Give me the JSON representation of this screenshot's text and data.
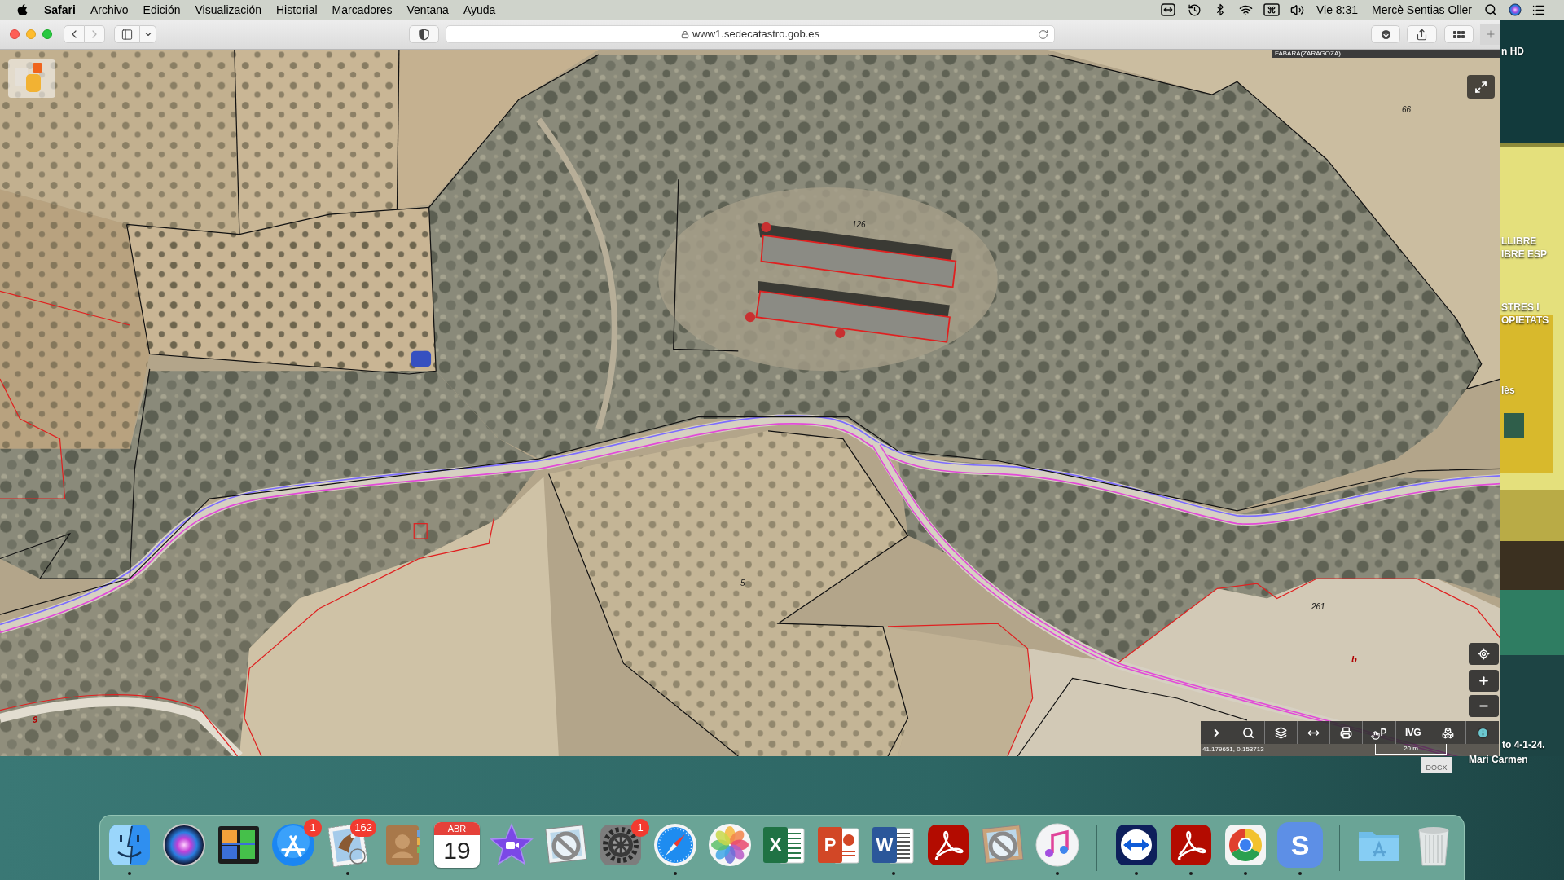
{
  "menu_bar": {
    "app_name": "Safari",
    "menus": [
      "Archivo",
      "Edición",
      "Visualización",
      "Historial",
      "Marcadores",
      "Ventana",
      "Ayuda"
    ],
    "clock": "Vie 8:31",
    "user": "Mercè Sentias Oller"
  },
  "browser": {
    "url": "www1.sedecatastro.gob.es",
    "back_disabled": false,
    "forward_disabled": true
  },
  "map": {
    "region_label": "FABARA(ZARAGOZA)",
    "parcel_labels": [
      {
        "text": "66",
        "kind": "parcel"
      },
      {
        "text": "126",
        "kind": "parcel"
      },
      {
        "text": "5",
        "kind": "parcel"
      },
      {
        "text": "261",
        "kind": "parcel"
      },
      {
        "text": "9",
        "kind": "subparcel"
      },
      {
        "text": "b",
        "kind": "subparcel"
      }
    ],
    "toolbar": [
      {
        "kind": "icon"
      },
      {
        "kind": "icon"
      },
      {
        "kind": "icon"
      },
      {
        "kind": "icon"
      },
      {
        "kind": "icon"
      },
      {
        "kind": "icon_letter",
        "label": "P"
      },
      {
        "kind": "text",
        "label": "IVG"
      },
      {
        "kind": "icon"
      },
      {
        "kind": "icon"
      }
    ],
    "coordinates": "41.179651, 0.153713",
    "scale": "20 m"
  },
  "desktop": {
    "labels": [
      "n HD",
      "LLIBRE",
      "IBRE ESP",
      "STRES I",
      "OPIETATS",
      "lès",
      "to 4-1-24.",
      "Mari Carmen"
    ],
    "file_type": "DOCX"
  },
  "dock": {
    "sections": [
      [
        {
          "running": true
        },
        {
          "running": false
        },
        {
          "running": false
        },
        {
          "running": false,
          "badge": "1"
        },
        {
          "running": true,
          "badge": "162"
        },
        {
          "running": false
        },
        {
          "running": false,
          "month": "ABR",
          "day": "19"
        },
        {
          "running": false
        },
        {
          "running": false
        },
        {
          "running": false,
          "badge": "1"
        },
        {
          "running": true
        },
        {
          "running": false
        },
        {
          "running": false,
          "glyph": "X"
        },
        {
          "running": false,
          "glyph": "P"
        },
        {
          "running": true,
          "glyph": "W"
        },
        {
          "running": false
        },
        {
          "running": false
        },
        {
          "running": true
        }
      ],
      [
        {
          "running": true
        },
        {
          "running": true
        },
        {
          "running": true
        },
        {
          "running": true,
          "glyph": "S"
        }
      ],
      [
        {
          "running": false
        },
        {
          "running": false
        }
      ]
    ]
  }
}
